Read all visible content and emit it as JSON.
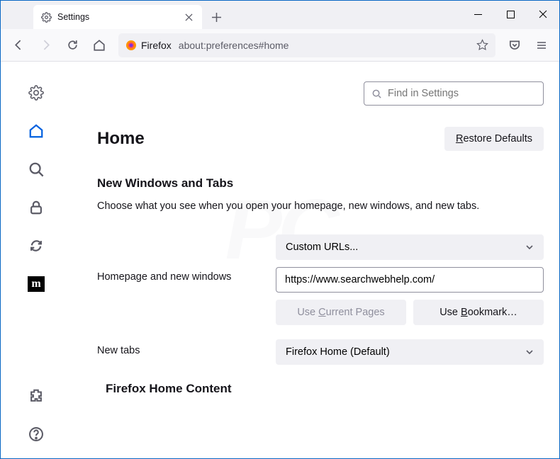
{
  "titlebar": {
    "tabTitle": "Settings"
  },
  "toolbar": {
    "identityLabel": "Firefox",
    "url": "about:preferences#home"
  },
  "search": {
    "placeholder": "Find in Settings"
  },
  "page": {
    "heading": "Home",
    "restoreDefaults": "Restore Defaults",
    "sectionTitle": "New Windows and Tabs",
    "sectionDesc": "Choose what you see when you open your homepage, new windows, and new tabs.",
    "homepageLabel": "Homepage and new windows",
    "homepageDropdown": "Custom URLs...",
    "homepageUrl": "https://www.searchwebhelp.com/",
    "useCurrent": "Use Current Pages",
    "useBookmark": "Use Bookmark…",
    "newTabsLabel": "New tabs",
    "newTabsDropdown": "Firefox Home (Default)",
    "contentSection": "Firefox Home Content"
  }
}
